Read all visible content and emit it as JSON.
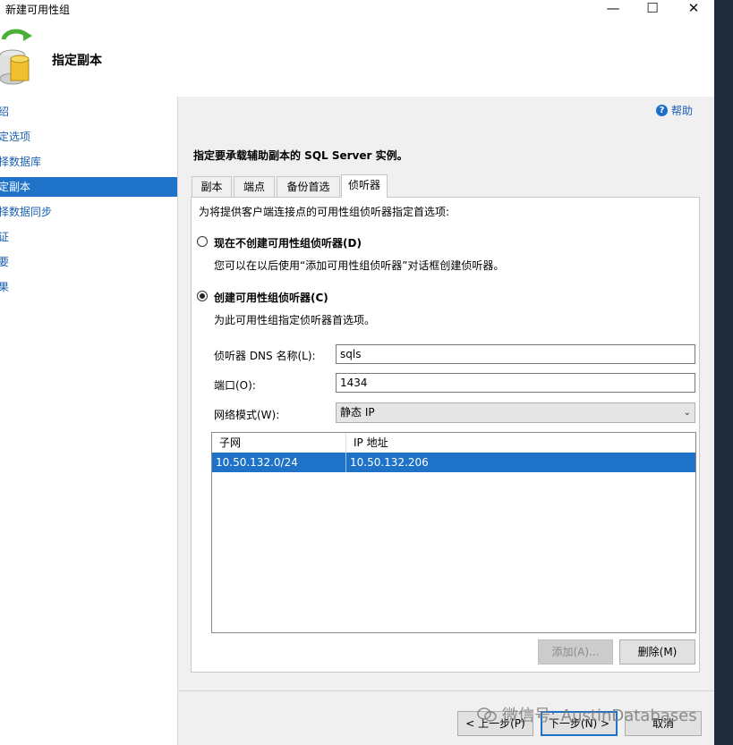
{
  "window": {
    "title": "新建可用性组"
  },
  "header": {
    "heading": "指定副本"
  },
  "sidebar": {
    "items": [
      {
        "label": "介绍"
      },
      {
        "label": "指定选项"
      },
      {
        "label": "选择数据库"
      },
      {
        "label": "指定副本"
      },
      {
        "label": "选择数据同步"
      },
      {
        "label": "验证"
      },
      {
        "label": "摘要"
      },
      {
        "label": "结果"
      }
    ]
  },
  "help": {
    "label": "帮助"
  },
  "instruction": "指定要承载辅助副本的 SQL Server 实例。",
  "tabs": [
    {
      "label": "副本"
    },
    {
      "label": "端点"
    },
    {
      "label": "备份首选项"
    },
    {
      "label": "侦听器"
    }
  ],
  "listener": {
    "description": "为将提供客户端连接点的可用性组侦听器指定首选项:",
    "option_none": {
      "label": "现在不创建可用性组侦听器(D)",
      "description": "您可以在以后使用“添加可用性组侦听器”对话框创建侦听器。",
      "checked": false
    },
    "option_create": {
      "label": "创建可用性组侦听器(C)",
      "description": "为此可用性组指定侦听器首选项。",
      "checked": true
    },
    "dns_label": "侦听器 DNS 名称(L):",
    "dns_value": "sqls",
    "port_label": "端口(O):",
    "port_value": "1434",
    "network_mode_label": "网络模式(W):",
    "network_mode_value": "静态 IP",
    "grid": {
      "columns": [
        "子网",
        "IP 地址"
      ],
      "rows": [
        {
          "subnet": "10.50.132.0/24",
          "ip": "10.50.132.206"
        }
      ]
    },
    "add_button": "添加(A)...",
    "remove_button": "删除(M)"
  },
  "footer": {
    "prev_button": "< 上一步(P)",
    "next_button": "下一步(N) >",
    "cancel_button": "取消"
  },
  "watermark": "微信号: AustinDatabases",
  "colors": {
    "selection": "#1e73c8",
    "link": "#1a5fb4",
    "panel_bg": "#f0f0f0"
  }
}
